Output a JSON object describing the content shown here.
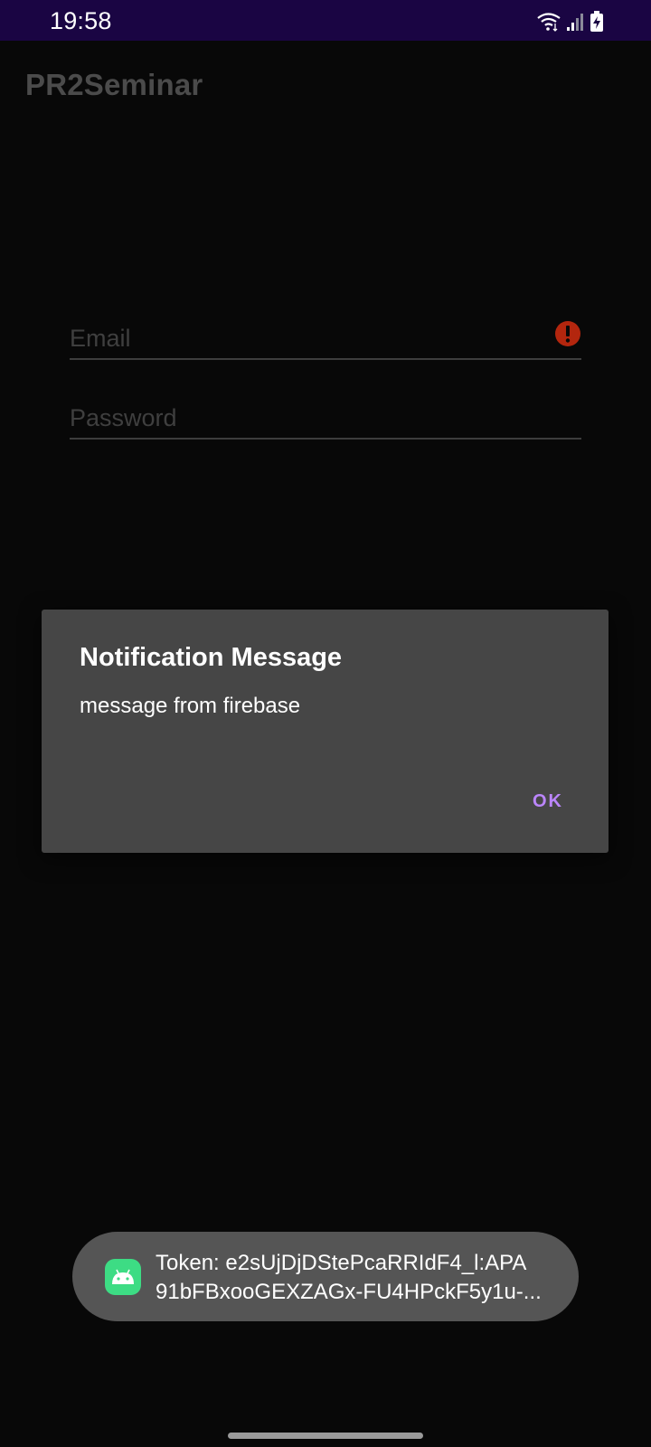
{
  "status_bar": {
    "time": "19:58",
    "icons": [
      "wifi-icon",
      "signal-icon",
      "battery-charging-icon"
    ],
    "background": "#1a0543"
  },
  "app_bar": {
    "title": "PR2Seminar"
  },
  "login_form": {
    "email": {
      "placeholder": "Email",
      "value": "",
      "error_icon": "error-icon",
      "error_color": "#b3260e"
    },
    "password": {
      "placeholder": "Password",
      "value": ""
    }
  },
  "dialog": {
    "title": "Notification Message",
    "message": "message from firebase",
    "positive_button": "OK",
    "button_color": "#bb86fc"
  },
  "toast": {
    "icon": "android-app-icon",
    "line1": "Token: e2sUjDjDStePcaRRIdF4_l:APA",
    "line2": "91bFBxooGEXZAGx-FU4HPckF5y1u-..."
  },
  "navigation": {
    "handle": "gesture-handle"
  }
}
